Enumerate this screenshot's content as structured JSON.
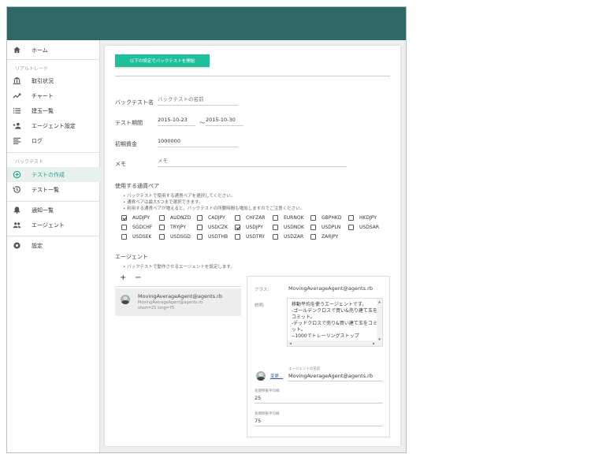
{
  "sidebar": {
    "home": "ホーム",
    "section_real": "リアルトレード",
    "trading_status": "取引状況",
    "chart": "チャート",
    "positions": "建玉一覧",
    "agent_settings": "エージェント設定",
    "log": "ログ",
    "section_backtest": "バックテスト",
    "create_test": "テストの作成",
    "test_list": "テスト一覧",
    "notifications": "通知一覧",
    "agents": "エージェント",
    "settings": "設定"
  },
  "form": {
    "start_button": "以下の設定でバックテストを開始",
    "name_label": "バックテスト名",
    "name_placeholder": "バックテストの名前",
    "period_label": "テスト期間",
    "period_start": "2015-10-23",
    "period_sep": "～",
    "period_end": "2015-10-30",
    "balance_label": "初期資金",
    "balance_value": "1000000",
    "memo_label": "メモ",
    "memo_placeholder": "メモ"
  },
  "pairs_section": {
    "title": "使用する通貨ペア",
    "notes": [
      "バックテストで使用する通貨ペアを選択してください。",
      "通貨ペアは最大5つまで選択できます。",
      "利用する通貨ペアが増えると、バックテストの所要時間も増加しますのでご注意ください。"
    ],
    "pairs": [
      {
        "name": "AUDJPY",
        "checked": true
      },
      {
        "name": "AUDNZD",
        "checked": false
      },
      {
        "name": "CADJPY",
        "checked": false
      },
      {
        "name": "CHFZAR",
        "checked": false
      },
      {
        "name": "EURNOK",
        "checked": false
      },
      {
        "name": "GBPHKD",
        "checked": false
      },
      {
        "name": "HKDJPY",
        "checked": false
      },
      {
        "name": "SGDCHF",
        "checked": false
      },
      {
        "name": "TRYJPY",
        "checked": false
      },
      {
        "name": "USDCZK",
        "checked": false
      },
      {
        "name": "USDJPY",
        "checked": true
      },
      {
        "name": "USDNOK",
        "checked": false
      },
      {
        "name": "USDPLN",
        "checked": false
      },
      {
        "name": "USDSAR",
        "checked": false
      },
      {
        "name": "USDSEK",
        "checked": false
      },
      {
        "name": "USDSGD",
        "checked": false
      },
      {
        "name": "USDTHB",
        "checked": false
      },
      {
        "name": "USDTRY",
        "checked": false
      },
      {
        "name": "USDZAR",
        "checked": false
      },
      {
        "name": "ZARJPY",
        "checked": false
      }
    ]
  },
  "agents_section": {
    "title": "エージェント",
    "note": "バックテストで動作させるエージェントを設定します。",
    "add": "+",
    "remove": "−",
    "list": [
      {
        "name": "MovingAverageAgent@agents.rb",
        "class": "MovingAverageAgent@agents.rb",
        "params": "short=25 long=75"
      }
    ]
  },
  "detail": {
    "class_label": "クラス:",
    "class_value": "MovingAverageAgent@agents.rb",
    "desc_label": "説明:",
    "desc_lines": [
      "移動平均を使うエージェントです。",
      "-ゴールデンクロスで買い&売り建て玉を",
      "コミット。",
      "-デッドクロスで売り&買い建て玉をコミ",
      "ット。",
      "--1000でトレーリングストップ"
    ],
    "change_link": "変更...",
    "agent_name_label": "エージェントの名前",
    "agent_name_value": "MovingAverageAgent@agents.rb",
    "short_label": "短期移動平均線",
    "short_value": "25",
    "long_label": "長期移動平均線",
    "long_value": "75"
  }
}
